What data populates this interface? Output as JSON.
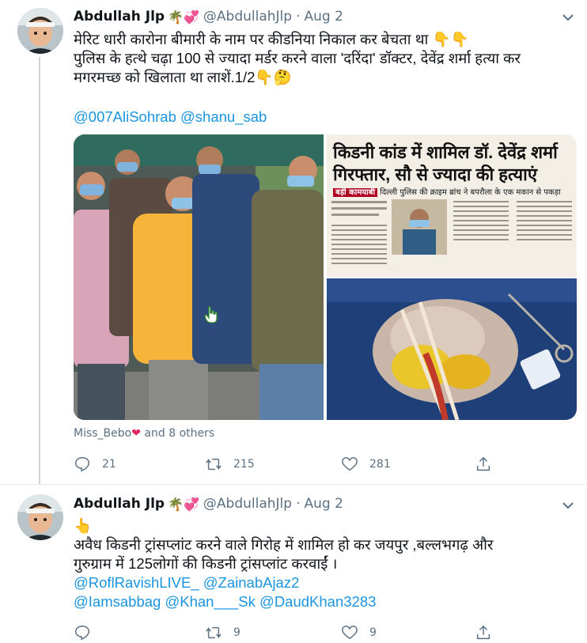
{
  "tweets": [
    {
      "author": {
        "name": "Abdullah Jlp",
        "name_emoji": "🌴💞",
        "handle": "@AbdullahJlp"
      },
      "separator": "·",
      "date": "Aug 2",
      "text_lines": [
        "मेरिट धारी कारोना बीमारी के नाम पर कीडनिया निकाल कर  बेचता था 👇👇",
        "पुलिस के हत्थे चढ़ा 100 से ज्यादा मर्डर करने वाला 'दरिंदा' डॉक्टर, देवेंद्र शर्मा हत्या कर",
        "मगरमच्छ को खिलाता था लाशें.1/2👇🤔"
      ],
      "mentions": "@007AliSohrab @shanu_sab",
      "media": {
        "news_headline_1": "किडनी कांड में शामिल डॉ. देवेंद्र शर्मा",
        "news_headline_2": "गिरफ्तार, सौ से ज्यादा की हत्याएं",
        "news_tag": "बड़ी कामयाबी",
        "news_sub": "दिल्ली पुलिस की क्राइम ब्रांच ने बपरौला के एक मकान से पकड़ा"
      },
      "liked_by": {
        "name": "Miss_Bebo",
        "heart": "❤",
        "rest": "and 8 others"
      },
      "actions": {
        "replies": "21",
        "retweets": "215",
        "likes": "281"
      }
    },
    {
      "author": {
        "name": "Abdullah Jlp",
        "name_emoji": "🌴💞",
        "handle": "@AbdullahJlp"
      },
      "separator": "·",
      "date": "Aug 2",
      "text_lines": [
        "👆",
        "अवैध किडनी ट्रांसप्लांट करने वाले गिरोह में शामिल हो कर  जयपुर ,बल्लभगढ़ और",
        "गुरुग्राम में 125लोगों की किडनी ट्रांसप्लांट करवाईं ।"
      ],
      "mention_lines": [
        "@RoflRavishLIVE_ @ZainabAjaz2",
        "@Iamsabbag @Khan___Sk @DaudKhan3283"
      ],
      "actions": {
        "replies": "",
        "retweets": "9",
        "likes": "9"
      }
    }
  ],
  "colors": {
    "link": "#1b95e0",
    "muted": "#5b7083",
    "heart": "#e0245e",
    "line": "#ccd6dd"
  },
  "icons": [
    "avatar",
    "chevron-down-icon",
    "reply-icon",
    "retweet-icon",
    "like-icon",
    "share-icon",
    "hand-cursor-icon"
  ]
}
